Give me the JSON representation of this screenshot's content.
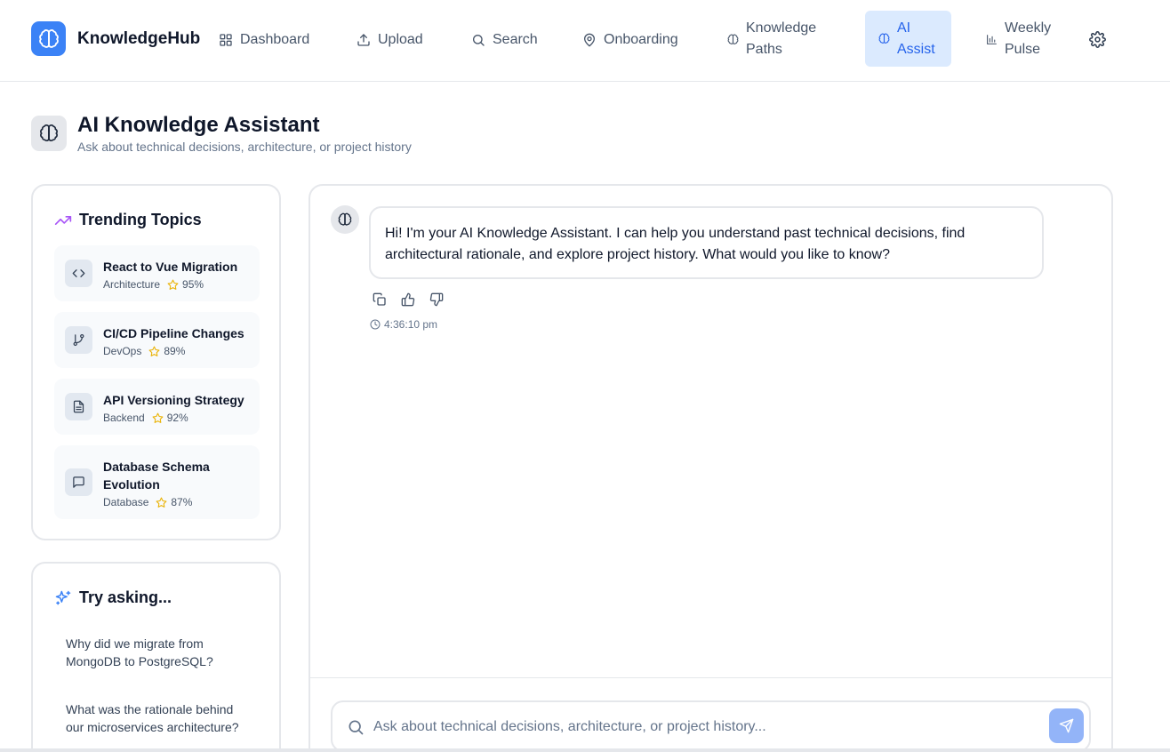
{
  "app": {
    "name": "KnowledgeHub"
  },
  "nav": {
    "items": [
      {
        "id": "dashboard",
        "label": "Dashboard",
        "icon": "grid-icon"
      },
      {
        "id": "upload",
        "label": "Upload",
        "icon": "upload-icon"
      },
      {
        "id": "search",
        "label": "Search",
        "icon": "search-icon"
      },
      {
        "id": "onboarding",
        "label": "Onboarding",
        "icon": "map-pin-icon"
      },
      {
        "id": "knowledge_paths",
        "label_line1": "Knowledge",
        "label_line2": "Paths",
        "icon": "brain-icon"
      },
      {
        "id": "ai_assist",
        "label_line1": "AI",
        "label_line2": "Assist",
        "icon": "brain-icon",
        "active": true
      },
      {
        "id": "weekly_pulse",
        "label_line1": "Weekly",
        "label_line2": "Pulse",
        "icon": "bar-chart-icon"
      }
    ],
    "settings_icon": "gear-icon"
  },
  "page": {
    "title": "AI Knowledge Assistant",
    "subtitle": "Ask about technical decisions, architecture, or project history"
  },
  "trending": {
    "title": "Trending Topics",
    "icon": "trending-up-icon",
    "topics": [
      {
        "name": "React to Vue Migration",
        "category": "Architecture",
        "score": "95%",
        "icon": "code-icon"
      },
      {
        "name": "CI/CD Pipeline Changes",
        "category": "DevOps",
        "score": "89%",
        "icon": "git-branch-icon"
      },
      {
        "name": "API Versioning Strategy",
        "category": "Backend",
        "score": "92%",
        "icon": "file-text-icon"
      },
      {
        "name": "Database Schema Evolution",
        "category": "Database",
        "score": "87%",
        "icon": "message-square-icon"
      }
    ]
  },
  "suggestions": {
    "title": "Try asking...",
    "icon": "sparkles-icon",
    "items": [
      "Why did we migrate from MongoDB to PostgreSQL?",
      "What was the rationale behind our microservices architecture?"
    ]
  },
  "chat": {
    "messages": [
      {
        "role": "assistant",
        "text": "Hi! I'm your AI Knowledge Assistant. I can help you understand past technical decisions, find architectural rationale, and explore project history. What would you like to know?",
        "time": "4:36:10 pm"
      }
    ],
    "actions": [
      "copy-icon",
      "thumbs-up-icon",
      "thumbs-down-icon"
    ],
    "input": {
      "value": "",
      "placeholder": "Ask about technical decisions, architecture, or project history..."
    },
    "send_icon": "send-icon"
  },
  "colors": {
    "accent": "#3b82f6",
    "active_nav_bg": "#dbeafe",
    "active_nav_text": "#2563eb",
    "star": "#eab308",
    "trending_icon": "#a855f7",
    "send_button": "#93b4f8"
  }
}
